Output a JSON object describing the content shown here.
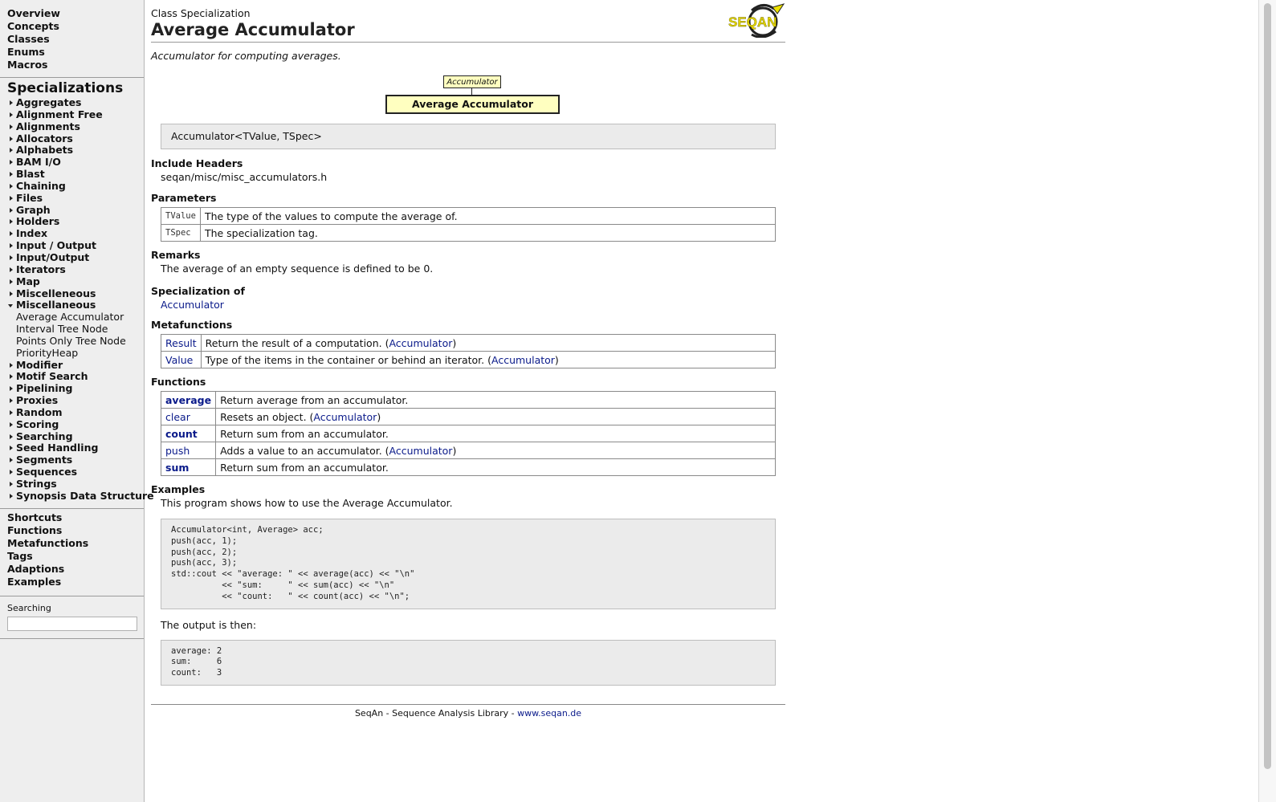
{
  "sidebar": {
    "top_links": [
      "Overview",
      "Concepts",
      "Classes",
      "Enums",
      "Macros"
    ],
    "specializations_heading": "Specializations",
    "items_before": [
      "Aggregates",
      "Alignment Free",
      "Alignments",
      "Allocators",
      "Alphabets",
      "BAM I/O",
      "Blast",
      "Chaining",
      "Files",
      "Graph",
      "Holders",
      "Index",
      "Input / Output",
      "Input/Output",
      "Iterators",
      "Map",
      "Miscelleneous"
    ],
    "open_item": "Miscellaneous",
    "sub_items": [
      "Average Accumulator",
      "Interval Tree Node",
      "Points Only Tree Node",
      "PriorityHeap"
    ],
    "items_after": [
      "Modifier",
      "Motif Search",
      "Pipelining",
      "Proxies",
      "Random",
      "Scoring",
      "Searching",
      "Seed Handling",
      "Segments",
      "Sequences",
      "Strings",
      "Synopsis Data Structure"
    ],
    "bottom_links": [
      "Shortcuts",
      "Functions",
      "Metafunctions",
      "Tags",
      "Adaptions",
      "Examples"
    ],
    "search_label": "Searching",
    "search_value": ""
  },
  "page": {
    "kind": "Class Specialization",
    "title": "Average Accumulator",
    "summary": "Accumulator for computing averages.",
    "logo_text": "SEQAN",
    "diagram": {
      "parent": "Accumulator",
      "self": "Average Accumulator"
    },
    "signature": "Accumulator<TValue, TSpec>"
  },
  "include": {
    "heading": "Include Headers",
    "path": "seqan/misc/misc_accumulators.h"
  },
  "parameters": {
    "heading": "Parameters",
    "rows": [
      {
        "name": "TValue",
        "desc": "The type of the values to compute the average of."
      },
      {
        "name": "TSpec",
        "desc": "The specialization tag."
      }
    ]
  },
  "remarks": {
    "heading": "Remarks",
    "text": "The average of an empty sequence is defined to be 0."
  },
  "specialization_of": {
    "heading": "Specialization of",
    "link": "Accumulator"
  },
  "metafunctions": {
    "heading": "Metafunctions",
    "rows": [
      {
        "name": "Result",
        "desc": "Return the result of a computation. (",
        "link": "Accumulator",
        "close": ")"
      },
      {
        "name": "Value",
        "desc": "Type of the items in the container or behind an iterator. (",
        "link": "Accumulator",
        "close": ")"
      }
    ]
  },
  "functions": {
    "heading": "Functions",
    "rows": [
      {
        "name": "average",
        "bold": true,
        "desc": "Return average from an accumulator.",
        "link": "",
        "close": ""
      },
      {
        "name": "clear",
        "bold": false,
        "desc": "Resets an object. (",
        "link": "Accumulator",
        "close": ")"
      },
      {
        "name": "count",
        "bold": true,
        "desc": "Return sum from an accumulator.",
        "link": "",
        "close": ""
      },
      {
        "name": "push",
        "bold": false,
        "desc": "Adds a value to an accumulator. (",
        "link": "Accumulator",
        "close": ")"
      },
      {
        "name": "sum",
        "bold": true,
        "desc": "Return sum from an accumulator.",
        "link": "",
        "close": ""
      }
    ]
  },
  "examples": {
    "heading": "Examples",
    "intro": "This program shows how to use the Average Accumulator.",
    "code": "Accumulator<int, Average> acc;\npush(acc, 1);\npush(acc, 2);\npush(acc, 3);\nstd::cout << \"average: \" << average(acc) << \"\\n\"\n          << \"sum:     \" << sum(acc) << \"\\n\"\n          << \"count:   \" << count(acc) << \"\\n\";",
    "output_intro": "The output is then:",
    "output": "average: 2\nsum:     6\ncount:   3"
  },
  "footer": {
    "text": "SeqAn - Sequence Analysis Library - ",
    "link": "www.seqan.de"
  },
  "colors": {
    "link": "#0a1a8a",
    "sidebar_bg": "#eeeeee",
    "box_bg": "#ffffc0",
    "code_bg": "#ebebeb"
  }
}
